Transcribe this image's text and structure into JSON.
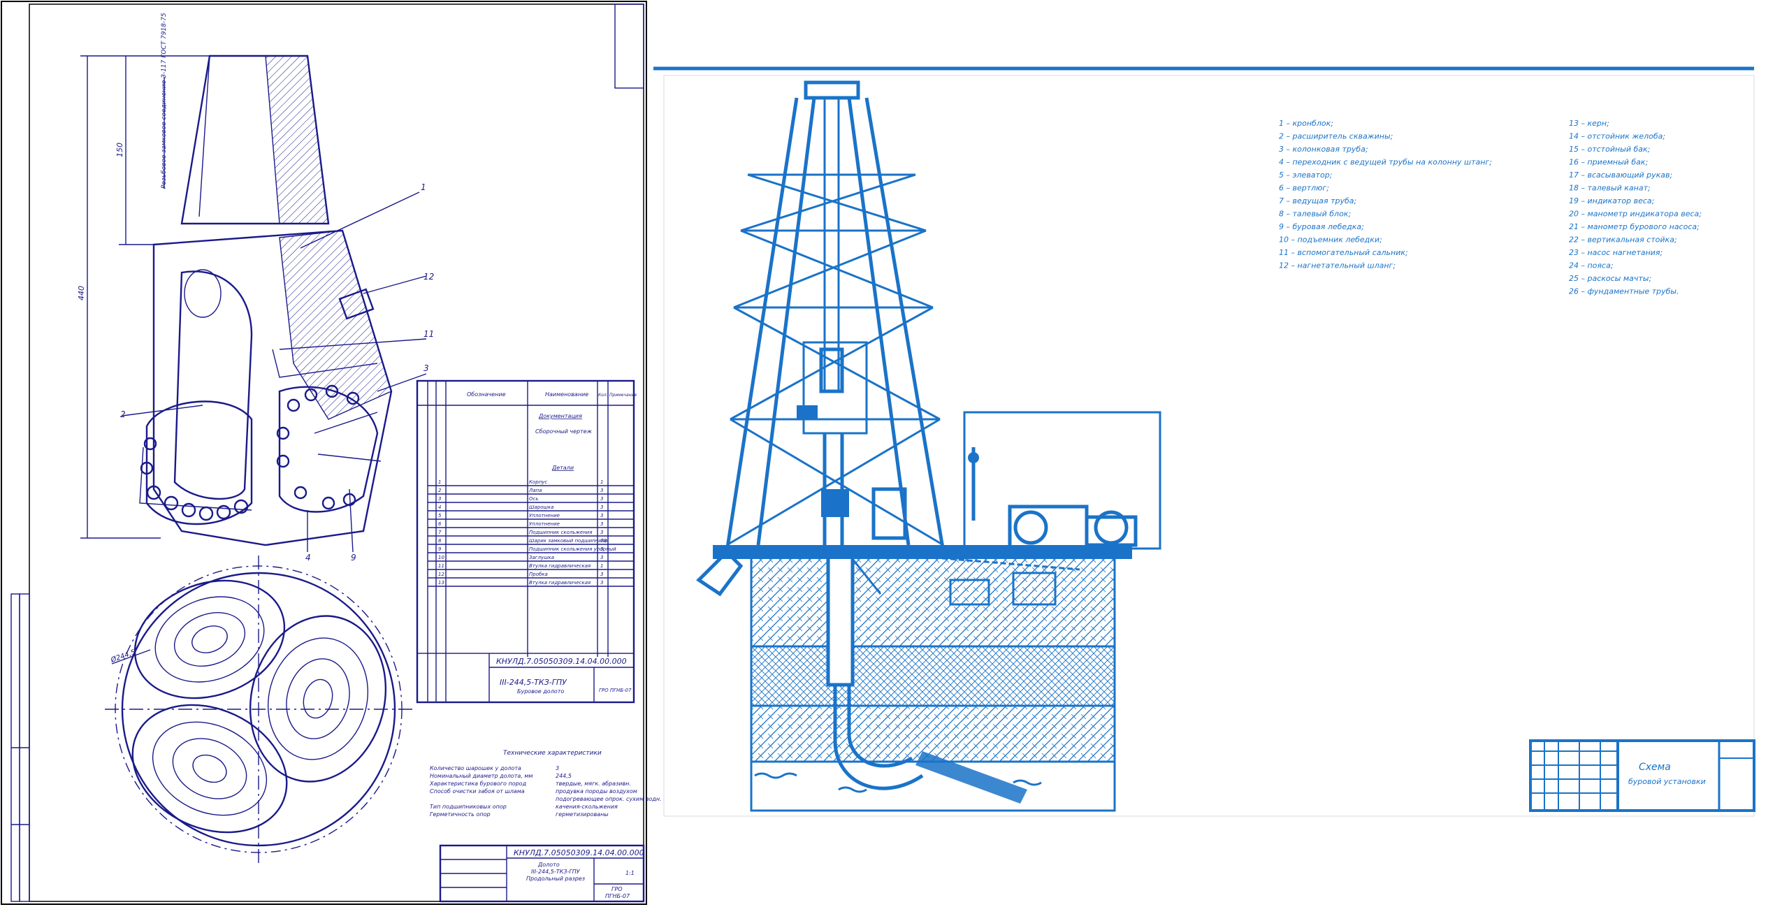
{
  "left_sheet": {
    "stamp_code": "КНУЛД.7.05050309.14.04.00.000",
    "stamp_title_1": "Долото",
    "stamp_title_2": "III-244,5-ТКЗ-ГПУ",
    "stamp_title_3": "Продольный разрез",
    "stamp_org_1": "ГРО",
    "stamp_org_2": "ПГНБ-07",
    "stamp_scale": "1:1",
    "char_title": "Технические характеристики",
    "characteristics": [
      {
        "label": "Количество шарошек у долота",
        "value": "3"
      },
      {
        "label": "Номинальный диаметр долота, мм",
        "value": "244,5"
      },
      {
        "label": "Характеристика бурового пород",
        "value": "твердые, мягк. абразивн."
      },
      {
        "label": "Способ очистки забоя от шлама",
        "value": "продувка породы воздухом"
      },
      {
        "label": "",
        "value": "подогревающее опрок. сухим водн."
      },
      {
        "label": "Тип подшипниковых опор",
        "value": "качения-скольжения"
      },
      {
        "label": "Герметичность опор",
        "value": "герметизированы"
      }
    ],
    "dims": {
      "d1": "150",
      "d2": "440",
      "d3": "Ø244,5",
      "note": "Резьбовое замковое соединение З-117 ГОСТ 7918-75"
    },
    "callouts": [
      "1",
      "2",
      "3",
      "4",
      "9",
      "11",
      "12"
    ]
  },
  "spec_table": {
    "headers": [
      "Поз.",
      "Обозначение",
      "Наименование",
      "Кол.",
      "Примечание"
    ],
    "section_docs": "Документация",
    "doc_item": "Сборочный чертеж",
    "section_parts": "Детали",
    "rows": [
      {
        "pos": "1",
        "name": "Корпус",
        "qty": "1"
      },
      {
        "pos": "2",
        "name": "Лапа",
        "qty": "3"
      },
      {
        "pos": "3",
        "name": "Ось",
        "qty": "3"
      },
      {
        "pos": "4",
        "name": "Шарошка",
        "qty": "3"
      },
      {
        "pos": "5",
        "name": "Уплотнение",
        "qty": "3"
      },
      {
        "pos": "6",
        "name": "Уплотнение",
        "qty": "3"
      },
      {
        "pos": "7",
        "name": "Подшипник скольжения",
        "qty": "3"
      },
      {
        "pos": "8",
        "name": "Шарик замковый подшипника",
        "qty": "78"
      },
      {
        "pos": "9",
        "name": "Подшипник скольжения упорный",
        "qty": "3"
      },
      {
        "pos": "10",
        "name": "Заглушка",
        "qty": "3"
      },
      {
        "pos": "11",
        "name": "Втулка гидравлическая",
        "qty": "1"
      },
      {
        "pos": "12",
        "name": "Пробка",
        "qty": "3"
      },
      {
        "pos": "13",
        "name": "Втулка гидравлическая",
        "qty": "3"
      }
    ],
    "stamp_code": "КНУЛД.7.05050309.14.04.00.000",
    "stamp_title_1": "III-244,5-ТКЗ-ГПУ",
    "stamp_title_2": "Буровое долото",
    "stamp_org": "ГРО ПГНБ-07"
  },
  "right_sheet": {
    "legend_left": [
      "1 – кронблок;",
      "2 – расширитель скважины;",
      "3 – колонковая труба;",
      "4 – переходник с ведущей трубы на колонну штанг;",
      "5 – элеватор;",
      "6 – вертлюг;",
      "7 – ведущая труба;",
      "8 – талевый блок;",
      "9 – буровая лебедка;",
      "10 – подъемник лебедки;",
      "11 – вспомогательный сальник;",
      "12 – нагнетательный шланг;"
    ],
    "legend_right": [
      "13 – керн;",
      "14 – отстойник желоба;",
      "15 – отстойный бак;",
      "16 – приемный бак;",
      "17 – всасывающий рукав;",
      "18 – талевый канат;",
      "19 – индикатор веса;",
      "20 – манометр индикатора веса;",
      "21 – манометр бурового насоса;",
      "22 – вертикальная стойка;",
      "23 – насос нагнетания;",
      "24 – пояса;",
      "25 – раскосы мачты;",
      "26 – фундаментные трубы."
    ],
    "stamp_title_1": "Схема",
    "stamp_title_2": "буровой установки"
  }
}
